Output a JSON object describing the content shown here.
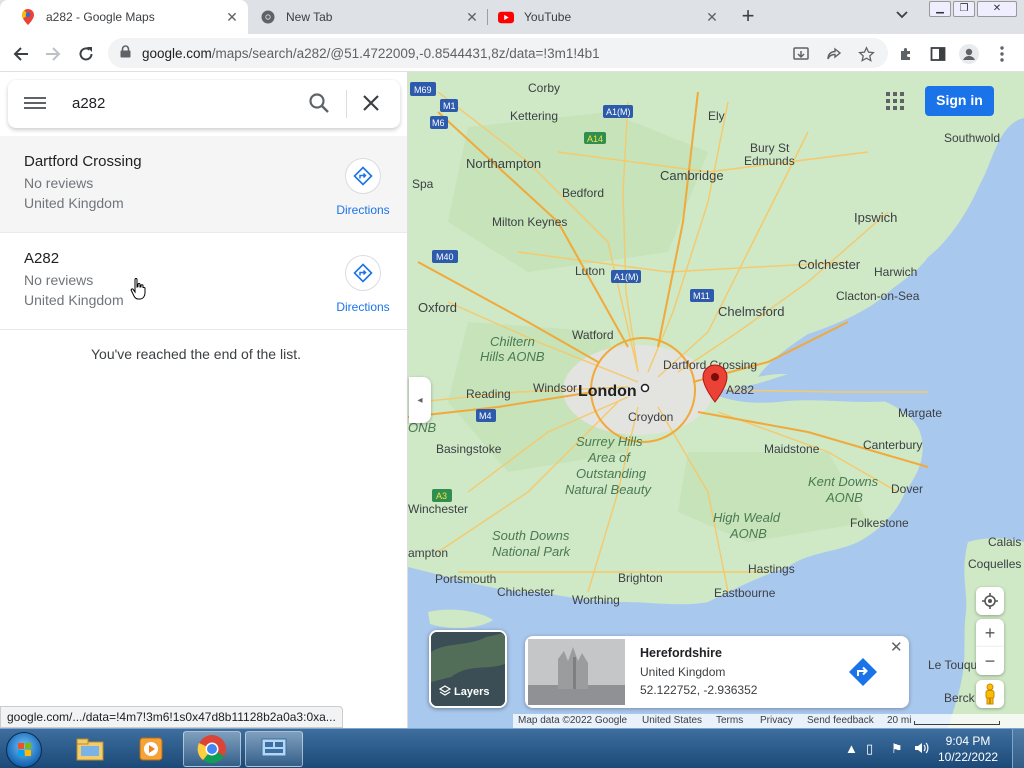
{
  "browser": {
    "tabs": [
      {
        "title": "a282 - Google Maps",
        "icon": "google-maps-pin-icon",
        "active": true
      },
      {
        "title": "New Tab",
        "icon": "chrome-icon",
        "active": false
      },
      {
        "title": "YouTube",
        "icon": "youtube-icon",
        "active": false
      }
    ],
    "url_domain": "google.com",
    "url_path": "/maps/search/a282/@51.4722009,-0.8544431,8z/data=!3m1!4b1",
    "status_link": "google.com/.../data=!4m7!3m6!1s0x47d8b11128b2a0a3:0xa..."
  },
  "search": {
    "query": "a282"
  },
  "results": [
    {
      "name": "Dartford Crossing",
      "reviews": "No reviews",
      "country": "United Kingdom",
      "directions_label": "Directions"
    },
    {
      "name": "A282",
      "reviews": "No reviews",
      "country": "United Kingdom",
      "directions_label": "Directions"
    }
  ],
  "end_of_list": "You've reached the end of the list.",
  "map": {
    "signin_label": "Sign in",
    "layers_label": "Layers",
    "labels": {
      "m69": "M69",
      "m1": "M1",
      "m6": "M6",
      "a1m_top": "A1(M)",
      "a14": "A14",
      "corby": "Corby",
      "kettering": "Kettering",
      "ely": "Ely",
      "bury": "Bury St",
      "edmunds": "Edmunds",
      "southwold": "Southwold",
      "northampton": "Northampton",
      "cambridge": "Cambridge",
      "spa": "Spa",
      "bedford": "Bedford",
      "milton_keynes": "Milton Keynes",
      "ipswich": "Ipswich",
      "luton": "Luton",
      "a1m": "A1(M)",
      "colchester": "Colchester",
      "harwich": "Harwich",
      "m40": "M40",
      "m11": "M11",
      "clacton": "Clacton-on-Sea",
      "oxford": "Oxford",
      "chelmsford": "Chelmsford",
      "watford": "Watford",
      "chiltern": "Chiltern",
      "hills_aonb": "Hills AONB",
      "dartford_crossing": "Dartford Crossing",
      "london": "London",
      "a282": "A282",
      "reading": "Reading",
      "windsor": "Windsor",
      "margate": "Margate",
      "m4": "M4",
      "onb": "ONB",
      "croydon": "Croydon",
      "basingstoke": "Basingstoke",
      "surrey_hills": "Surrey Hills",
      "area_of": "Area of",
      "outstanding": "Outstanding",
      "natural_beauty": "Natural Beauty",
      "maidstone": "Maidstone",
      "canterbury": "Canterbury",
      "kent_downs": "Kent Downs",
      "aonb_kent": "AONB",
      "dover": "Dover",
      "a3": "A3",
      "winchester": "Winchester",
      "high_weald": "High Weald",
      "aonb_weald": "AONB",
      "folkestone": "Folkestone",
      "calais": "Calais",
      "south_downs": "South Downs",
      "national_park": "National Park",
      "ampton": "ampton",
      "hastings": "Hastings",
      "coquelles": "Coquelles",
      "portsmouth": "Portsmouth",
      "brighton": "Brighton",
      "chichester": "Chichester",
      "eastbourne": "Eastbourne",
      "worthing": "Worthing",
      "le_touquet": "Le Touquet",
      "berck": "Berck"
    }
  },
  "info_card": {
    "title": "Herefordshire",
    "subtitle": "United Kingdom",
    "coords": "52.122752, -2.936352"
  },
  "attribution": {
    "map_data": "Map data ©2022 Google",
    "country": "United States",
    "terms": "Terms",
    "privacy": "Privacy",
    "feedback": "Send feedback",
    "scale": "20 mi"
  },
  "taskbar": {
    "time": "9:04 PM",
    "date": "10/22/2022"
  },
  "colors": {
    "accent": "#1a73e8",
    "water": "#a9c8ee",
    "land": "#cfe8c6",
    "pin": "#ea4335"
  }
}
